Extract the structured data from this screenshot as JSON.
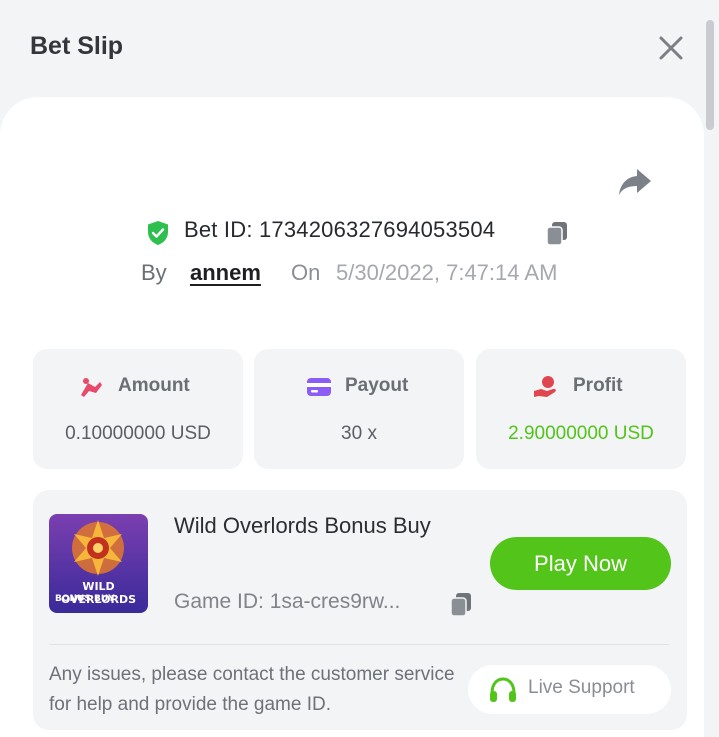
{
  "header": {
    "title": "Bet Slip",
    "close_icon": "close-icon"
  },
  "bet": {
    "id_text": "Bet ID: 1734206327694053504",
    "by_label": "By",
    "user": "annem",
    "on_label": "On",
    "date": "5/30/2022, 7:47:14 AM"
  },
  "stats": {
    "amount": {
      "label": "Amount",
      "value": "0.10000000 USD",
      "icon": "coins-icon"
    },
    "payout": {
      "label": "Payout",
      "value": "30 x",
      "icon": "card-icon"
    },
    "profit": {
      "label": "Profit",
      "value": "2.90000000 USD",
      "icon": "money-hand-icon",
      "value_color": "#52c41a"
    }
  },
  "game": {
    "name": "Wild Overlords Bonus Buy",
    "id_text": "Game ID: 1sa-cres9rw...",
    "thumb_line1": "WILD OVERLORDS",
    "thumb_line2": "BONUS BUY",
    "play_label": "Play Now"
  },
  "support": {
    "help_text": "Any issues, please contact the customer service for help and provide the game ID.",
    "button_label": "Live Support"
  },
  "colors": {
    "accent_green": "#52c41a",
    "amount_icon": "#e84a6a",
    "payout_icon": "#8b5cf6",
    "profit_icon": "#e0464f"
  }
}
